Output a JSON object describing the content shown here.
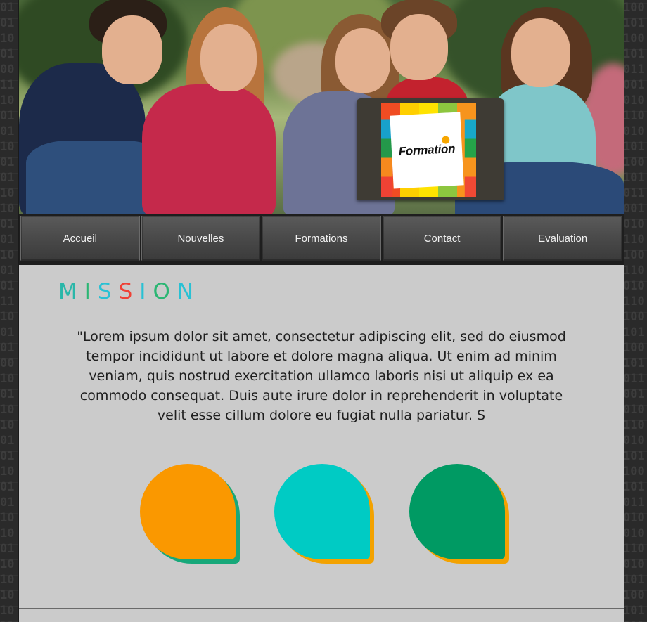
{
  "background": {
    "pattern": "binary-digits",
    "color": "#2a2a2a"
  },
  "hero": {
    "logo": {
      "text": "Formation",
      "accent_dot_color": "#f7a600"
    }
  },
  "nav": {
    "items": [
      {
        "label": "Accueil"
      },
      {
        "label": "Nouvelles"
      },
      {
        "label": "Formations"
      },
      {
        "label": "Contact"
      },
      {
        "label": "Evaluation"
      }
    ]
  },
  "mission": {
    "title_letters": [
      {
        "char": "M",
        "color": "#2ab7a9"
      },
      {
        "char": "I",
        "color": "#2bb673"
      },
      {
        "char": "S",
        "color": "#29c1d4"
      },
      {
        "char": "S",
        "color": "#ef4136"
      },
      {
        "char": "I",
        "color": "#29c1d4"
      },
      {
        "char": "O",
        "color": "#2bb673"
      },
      {
        "char": "N",
        "color": "#29c1d4"
      }
    ],
    "text": "\"Lorem ipsum dolor sit amet, consectetur adipiscing elit, sed do eiusmod tempor incididunt ut labore et dolore magna aliqua. Ut enim ad minim veniam, quis nostrud exercitation ullamco laboris nisi ut aliquip ex ea commodo consequat. Duis aute irure dolor in reprehenderit in voluptate velit esse cillum dolore eu fugiat nulla pariatur. S"
  },
  "blobs": [
    {
      "color": "#fa9800",
      "shadow_color": "#17a87a"
    },
    {
      "color": "#00cbc4",
      "shadow_color": "#f3a200"
    },
    {
      "color": "#009a63",
      "shadow_color": "#f3a200"
    }
  ]
}
